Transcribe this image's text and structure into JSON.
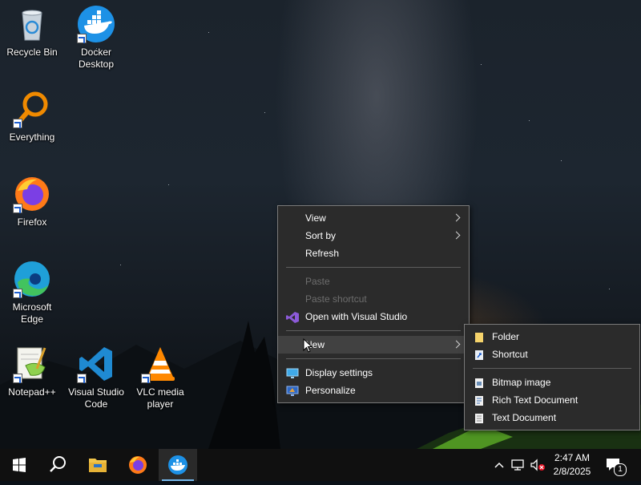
{
  "desktop": {
    "icons": [
      {
        "label": "Recycle Bin",
        "icon": "recycle-bin-icon"
      },
      {
        "label": "Docker Desktop",
        "icon": "docker-icon"
      },
      {
        "label": "Everything",
        "icon": "everything-search-icon"
      },
      {
        "label": "Firefox",
        "icon": "firefox-icon"
      },
      {
        "label": "Microsoft Edge",
        "icon": "edge-icon"
      },
      {
        "label": "Notepad++",
        "icon": "notepad-plus-plus-icon"
      },
      {
        "label": "Visual Studio Code",
        "icon": "vscode-icon"
      },
      {
        "label": "VLC media player",
        "icon": "vlc-icon"
      }
    ]
  },
  "context_menu": {
    "items": [
      {
        "label": "View",
        "has_submenu": true
      },
      {
        "label": "Sort by",
        "has_submenu": true
      },
      {
        "label": "Refresh"
      },
      {
        "label": "Paste",
        "disabled": true
      },
      {
        "label": "Paste shortcut",
        "disabled": true
      },
      {
        "label": "Open with Visual Studio",
        "icon": "visual-studio-icon"
      },
      {
        "label": "New",
        "has_submenu": true,
        "highlighted": true
      },
      {
        "label": "Display settings",
        "icon": "display-icon"
      },
      {
        "label": "Personalize",
        "icon": "personalize-icon"
      }
    ]
  },
  "new_submenu": {
    "items": [
      {
        "label": "Folder",
        "icon": "folder-icon"
      },
      {
        "label": "Shortcut",
        "icon": "shortcut-icon"
      },
      {
        "label": "Bitmap image",
        "icon": "bitmap-icon"
      },
      {
        "label": "Rich Text Document",
        "icon": "rtf-document-icon"
      },
      {
        "label": "Text Document",
        "icon": "text-document-icon"
      }
    ]
  },
  "taskbar": {
    "pinned": [
      "start-icon",
      "search-icon",
      "file-explorer-icon",
      "firefox-icon",
      "docker-icon"
    ],
    "active": "docker-icon",
    "clock": {
      "time": "2:47 AM",
      "date": "2/8/2025"
    },
    "notification_count": "1"
  },
  "colors": {
    "menu_bg": "#2b2b2b",
    "menu_hover": "#414141",
    "taskbar_bg": "#101010",
    "accent": "#76b9ed"
  }
}
